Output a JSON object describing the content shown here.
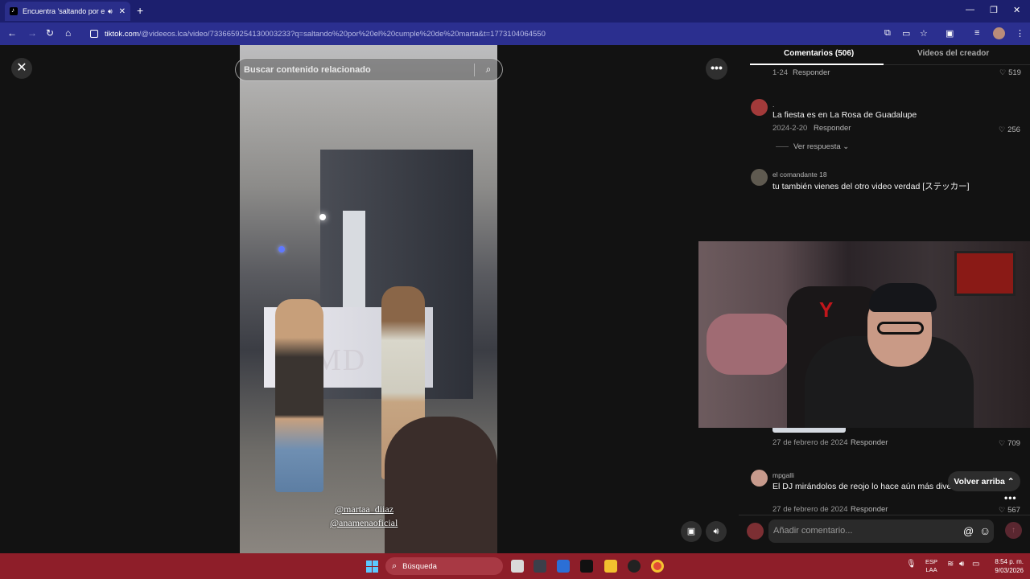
{
  "browser": {
    "tab_title": "Encuentra 'saltando por el c",
    "audio_icon": "speaker-icon",
    "url_host": "tiktok.com",
    "url_path": "/@videeos.lca/video/7336659254130003233?q=saltando%20por%20el%20cumple%20de%20marta&t=1773104064550"
  },
  "viewer": {
    "search_placeholder": "Buscar contenido relacionado",
    "tag_1": "@martaa_diiaz",
    "tag_2": "@anamenaoficial",
    "video_overlay_text": "MD"
  },
  "comments": {
    "tab_comments": "Comentarios (506)",
    "tab_creator": "Videos del creador",
    "reply_label": "Responder",
    "items": [
      {
        "date": "1-24",
        "likes": "519"
      },
      {
        "name": ".",
        "text": "La fiesta es en La Rosa de Guadalupe",
        "date": "2024-2-20",
        "likes": "256",
        "view_replies": "Ver respuesta"
      },
      {
        "name": "el comandante 18",
        "text": "tu también vienes del otro video verdad [ステッカー]"
      },
      {
        "date": "27 de febrero de 2024",
        "likes": "709"
      },
      {
        "name": "mpgalli",
        "text": "El DJ mirándolos de reojo lo hace aún más diverti",
        "date": "27 de febrero de 2024",
        "likes": "567"
      }
    ],
    "back_to_top": "Volver arriba",
    "add_comment_placeholder": "Añadir comentario..."
  },
  "taskbar": {
    "search_label": "Búsqueda",
    "lang_1": "ESP",
    "lang_2": "LAA",
    "time": "8:54 p. m.",
    "date": "9/03/2026"
  }
}
